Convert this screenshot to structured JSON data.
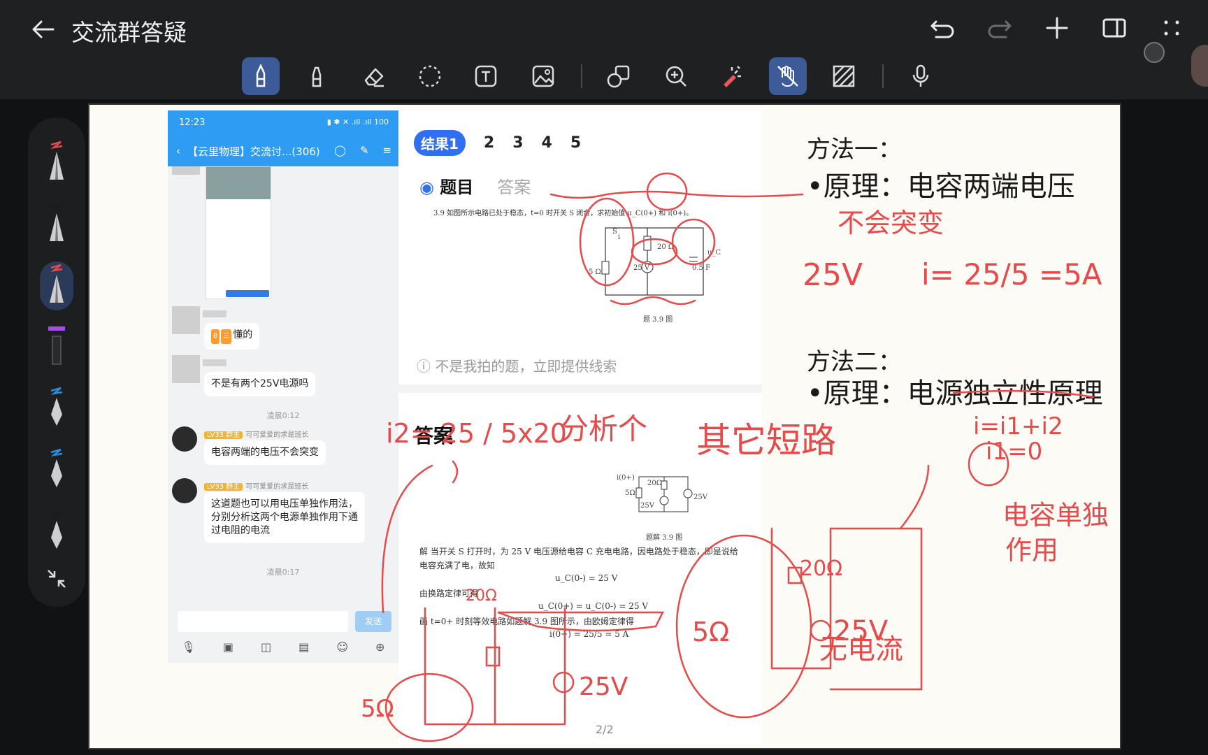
{
  "app": {
    "title": "交流群答疑",
    "icons": [
      "back-arrow-icon",
      "undo-icon",
      "redo-icon",
      "add-icon",
      "split-view-icon",
      "more-icon"
    ]
  },
  "toolbar": {
    "tools": [
      "pen-icon",
      "highlighter-icon",
      "eraser-icon",
      "lasso-icon",
      "text-icon",
      "image-icon",
      "shapes-icon",
      "zoom-icon",
      "laser-icon",
      "hand-draw-icon",
      "pattern-icon",
      "mic-icon"
    ]
  },
  "pens": [
    {
      "color": "#e24a4a"
    },
    {
      "color": "#1c1c1c"
    },
    {
      "color": "#e24a4a"
    },
    {
      "color": "#a64cf0"
    },
    {
      "color": "#2c8bd6"
    },
    {
      "color": "#2c8bd6"
    },
    {
      "color": "#1c1c1c"
    }
  ],
  "phone": {
    "time": "12:23",
    "battery": "100",
    "chat_title": "【云里物理】交流讨...(306)",
    "messages": [
      {
        "text": "懂的",
        "badges": [
          "B",
          "三"
        ]
      },
      {
        "text": "不是有两个25V电源吗"
      },
      {
        "time": "凌晨0:12"
      },
      {
        "role": "群主",
        "level": "LV33",
        "name": "可可爱爱的求是班长",
        "text": "电容两端的电压不会突变"
      },
      {
        "role": "群主",
        "level": "LV33",
        "name": "可可爱爱的求是班长",
        "text": "这道题也可以用电压单独作用法，分别分析这两个电源单独作用下通过电阻的电流"
      },
      {
        "time": "凌晨0:17"
      }
    ],
    "send_label": "发送"
  },
  "answer_panel": {
    "result_tab": "结果1",
    "other_tabs": [
      "2",
      "3",
      "4",
      "5"
    ],
    "section_tabs": {
      "question": "题目",
      "answer": "答案"
    },
    "problem_text": "3.9  如图所示电路已处于稳态，t=0 时开关 S 闭合，求初始值 u_C(0+) 和 i(0+)。",
    "figure_caption": "题 3.9 图",
    "figure_labels": [
      "S",
      "20 Ω",
      "5 Ω",
      "25 V",
      "0.5 F",
      "u_C",
      "i"
    ],
    "hint": "不是我拍的题，立即提供线索",
    "answer_title": "答案",
    "answer_figure_caption": "题解 3.9 图",
    "answer_figure_labels": [
      "i(0+)",
      "20Ω",
      "5Ω",
      "25V",
      "25V"
    ],
    "solution_lines": [
      "解   当开关 S 打开时，为 25 V 电压源给电容 C 充电电路，因电路处于稳态，即是说给",
      "电容充满了电，故知",
      "u_C(0-) = 25 V",
      "由换路定律可得",
      "u_C(0+) = u_C(0-) = 25 V",
      "画 t=0+ 时刻等效电路如题解 3.9 图所示，由欧姆定律得",
      "i(0+) = 25/5 = 5 A"
    ],
    "page_indicator": "2/2"
  },
  "handwriting": {
    "method1_title": "方法一：",
    "method1_principle": "•原理：电容两端电压",
    "method1_principle_2": "不会突变",
    "method1_calc_left": "25V",
    "method1_calc_right": "i= 25/5 =5A",
    "method2_title": "方法二：",
    "method2_principle": "•原理：电源独立性原理",
    "red_fraction": "i2= 25 / 5x20",
    "red_analyze": "分析个",
    "red_short": "其它短路",
    "red_sum": "i=i1+i2",
    "red_i1": "i1=0",
    "red_cap": "电容单独",
    "red_cap_2": "作用",
    "red_no_current": "无电流",
    "red_circuit_labels": [
      "20Ω",
      "25V",
      "5Ω",
      "20Ω",
      "25V",
      "5Ω"
    ]
  }
}
